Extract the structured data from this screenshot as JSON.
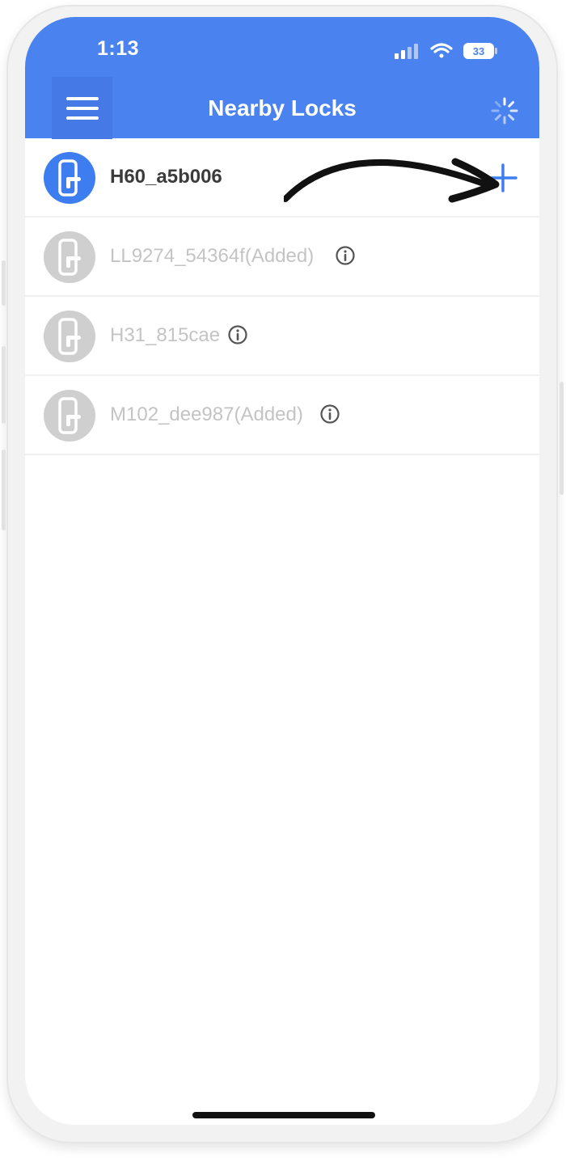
{
  "status_bar": {
    "time": "1:13",
    "battery": "33",
    "icons": [
      "cellular-signal-icon",
      "wifi-icon",
      "battery-icon"
    ]
  },
  "header": {
    "title": "Nearby Locks",
    "menu_icon": "hamburger-menu-icon",
    "loading_icon": "loading-spinner-icon",
    "color": "#4a83ef"
  },
  "locks": [
    {
      "name": "H60_a5b006",
      "active": true,
      "action_icon": "plus-icon"
    },
    {
      "name": "LL9274_54364f(Added)",
      "active": false,
      "info_icon": "info-icon"
    },
    {
      "name": "H31_815cae",
      "active": false,
      "info_icon": "info-icon"
    },
    {
      "name": "M102_dee987(Added)",
      "active": false,
      "info_icon": "info-icon"
    }
  ],
  "colors": {
    "accent": "#3d7df0",
    "inactive_avatar": "#cfcfcf",
    "inactive_text": "#c4c4c4"
  }
}
